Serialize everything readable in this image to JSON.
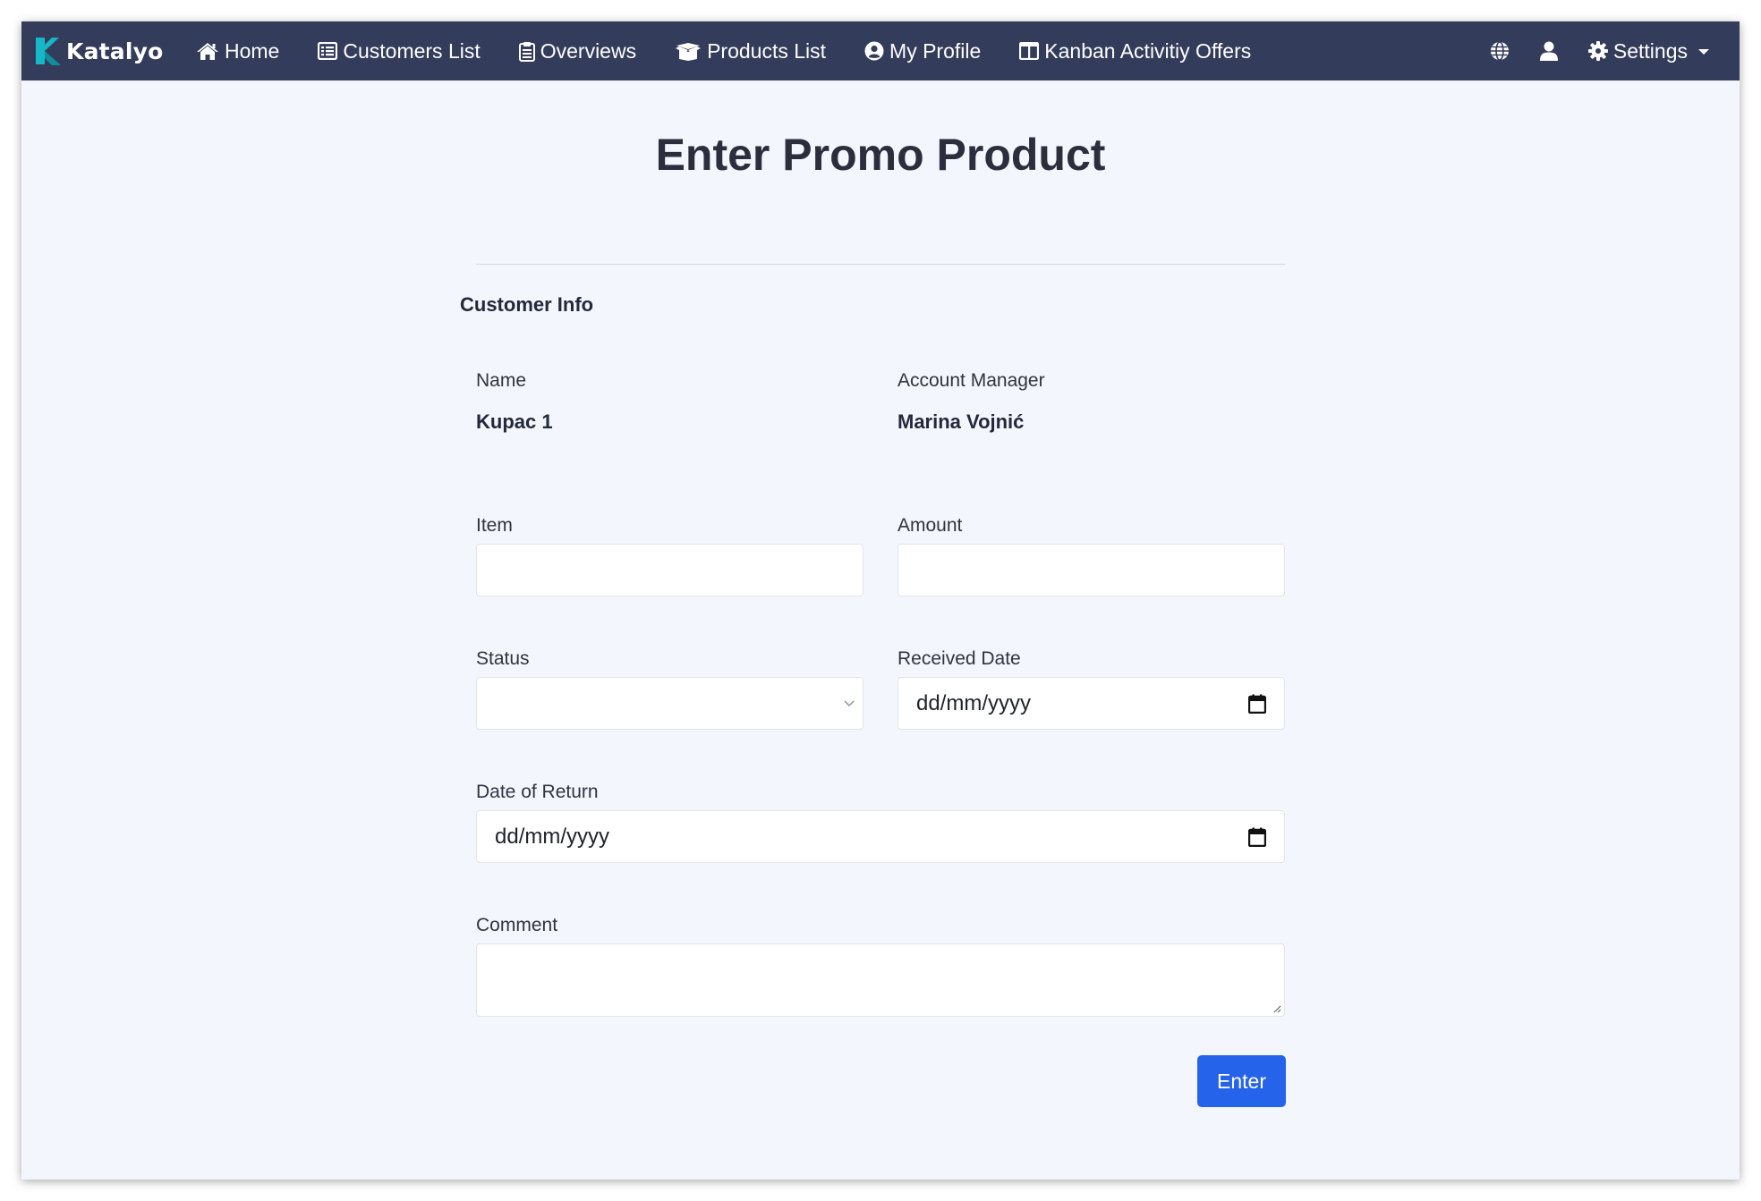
{
  "brand": {
    "name": "Katalyo",
    "logo_color": "#16b8c8"
  },
  "nav": {
    "items": [
      {
        "label": "Home",
        "icon": "home-icon"
      },
      {
        "label": "Customers List",
        "icon": "list-icon"
      },
      {
        "label": "Overviews",
        "icon": "clipboard-icon"
      },
      {
        "label": "Products List",
        "icon": "box-open-icon"
      },
      {
        "label": "My Profile",
        "icon": "user-circle-icon"
      },
      {
        "label": "Kanban Activitiy Offers",
        "icon": "columns-icon"
      }
    ],
    "right": {
      "globe_icon": "globe-icon",
      "user_icon": "user-icon",
      "settings_label": "Settings",
      "settings_icon": "gear-icon"
    },
    "bg_color": "#333c5a"
  },
  "page": {
    "title": "Enter Promo Product",
    "section_title": "Customer Info",
    "customer": {
      "name_label": "Name",
      "name_value": "Kupac 1",
      "manager_label": "Account Manager",
      "manager_value": "Marina Vojnić"
    },
    "form": {
      "item_label": "Item",
      "item_value": "",
      "amount_label": "Amount",
      "amount_value": "",
      "status_label": "Status",
      "status_value": "",
      "received_label": "Received Date",
      "received_placeholder": "dd/mm/yyyy",
      "return_label": "Date of Return",
      "return_placeholder": "dd/mm/yyyy",
      "comment_label": "Comment",
      "comment_value": ""
    },
    "submit_label": "Enter",
    "accent_color": "#2563eb"
  }
}
